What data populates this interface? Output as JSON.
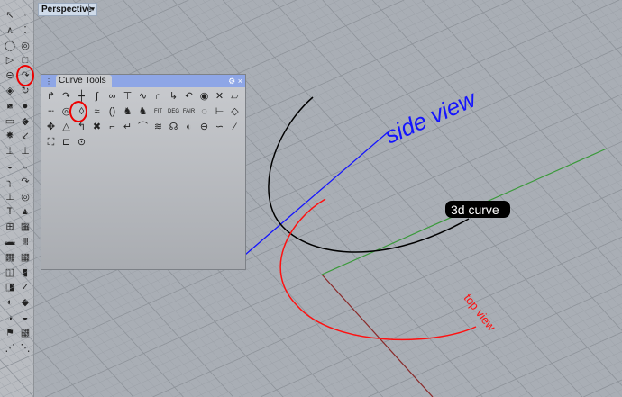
{
  "viewport": {
    "tab_label": "Perspective",
    "dropdown_icon": "▾"
  },
  "panel": {
    "title": "Curve Tools",
    "gear_icon": "⚙",
    "close_icon": "×",
    "icons": [
      "↱",
      "↷",
      "┿",
      "∫",
      "∞",
      "⊤",
      "∿",
      "∩",
      "↳",
      "↶",
      "◉",
      "✕",
      "▱",
      "┄",
      "◎",
      "◊",
      "≈",
      "()",
      "♞",
      "♞",
      "FIT",
      "DEG",
      "FAIR",
      "◌",
      "⊢",
      "◇",
      "✥",
      "△",
      "↰",
      "✖",
      "⌐",
      "↵",
      "⌒",
      "≋",
      "☊",
      "◐",
      "⊖",
      "∽",
      "⁄",
      "⛶",
      "⊏",
      "⊙"
    ]
  },
  "left_toolbar": [
    "↖",
    "·",
    "∧",
    "⁚",
    "◯",
    "◎",
    "▷",
    "□",
    "⊖",
    "↷",
    "◈",
    "↻",
    "■",
    "●",
    "▭",
    "◆",
    "✸",
    "↙",
    "⊥",
    "⊥",
    "◒",
    "◒",
    "╮",
    "↷",
    "⊥",
    "◎",
    "T",
    "▲",
    "⊞",
    "▦",
    "▬",
    "Ⅲ",
    "▦",
    "▦",
    "◫",
    "▮",
    "◨",
    "✓",
    "◐",
    "◆",
    "◑",
    "◒",
    "⚑",
    "▦",
    "⋰",
    "⋱"
  ],
  "annotations": {
    "side": "side view",
    "curve": "3d curve",
    "top": "top view"
  },
  "colors": {
    "blue": "#1414ff",
    "red": "#ff1010",
    "green": "#3a9a3a",
    "dark_red": "#8a2a2a"
  }
}
